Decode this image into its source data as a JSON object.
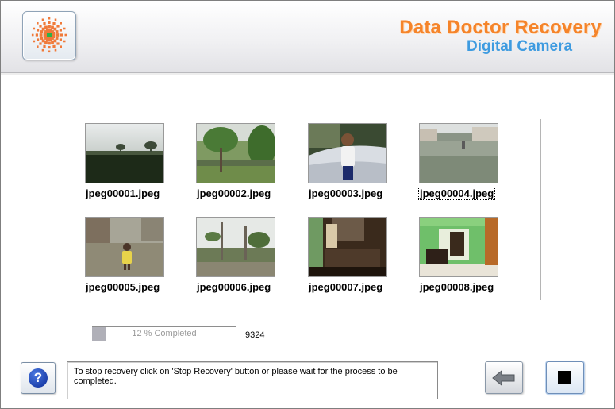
{
  "header": {
    "title": "Data Doctor Recovery",
    "subtitle": "Digital Camera",
    "logo_icon": "star-burst-logo-icon"
  },
  "thumbnails": [
    {
      "name": "jpeg00001.jpeg",
      "focused": false
    },
    {
      "name": "jpeg00002.jpeg",
      "focused": false
    },
    {
      "name": "jpeg00003.jpeg",
      "focused": false
    },
    {
      "name": "jpeg00004.jpeg",
      "focused": true
    },
    {
      "name": "jpeg00005.jpeg",
      "focused": false
    },
    {
      "name": "jpeg00006.jpeg",
      "focused": false
    },
    {
      "name": "jpeg00007.jpeg",
      "focused": false
    },
    {
      "name": "jpeg00008.jpeg",
      "focused": false
    }
  ],
  "progress": {
    "label": "12 % Completed",
    "fraction": 0.1,
    "count": "9324"
  },
  "footer": {
    "message": "To stop recovery click on 'Stop Recovery' button or please wait for the process to be completed.",
    "help_icon": "help-question-icon",
    "back_icon": "back-arrow-icon",
    "stop_icon": "stop-square-icon"
  },
  "colors": {
    "brand_orange": "#f5842a",
    "brand_blue": "#3e9be0"
  }
}
